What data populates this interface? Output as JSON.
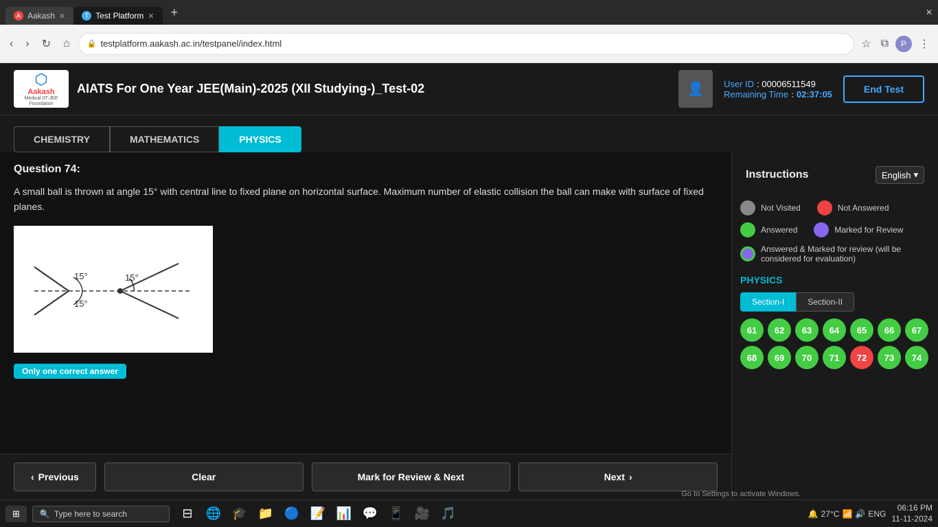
{
  "browser": {
    "tabs": [
      {
        "id": "aakash",
        "label": "Aakash",
        "active": false,
        "favicon": "A"
      },
      {
        "id": "test",
        "label": "Test Platform",
        "active": true,
        "favicon": "T"
      }
    ],
    "address": "testplatform.aakash.ac.in/testpanel/index.html",
    "new_tab_label": "+"
  },
  "header": {
    "logo_text": "Aakash",
    "logo_sub": "Medical IIT-JEE Foundation",
    "test_title": "AIATS For One Year JEE(Main)-2025 (XII Studying-)_Test-02",
    "user_id_label": "User ID",
    "user_id_value": ": 00006511549",
    "remaining_label": "Remaining Time",
    "remaining_value": ": 02:37:05",
    "end_test_label": "End Test"
  },
  "tabs": {
    "chemistry_label": "CHEMISTRY",
    "mathematics_label": "MATHEMATICS",
    "physics_label": "PHYSICS",
    "active": "PHYSICS"
  },
  "question": {
    "title": "Question 74:",
    "text": "A small ball is thrown at angle 15° with central line to fixed plane on horizontal surface. Maximum number of elastic collision the ball can make with surface of fixed planes.",
    "answer_type": "Only one correct answer"
  },
  "bottom_nav": {
    "prev_label": "Previous",
    "clear_label": "Clear",
    "mark_review_label": "Mark for Review & Next",
    "next_label": "Next"
  },
  "right_panel": {
    "instructions_label": "Instructions",
    "language_label": "English",
    "legend": {
      "not_visited_label": "Not Visited",
      "not_answered_label": "Not Answered",
      "answered_label": "Answered",
      "marked_review_label": "Marked for Review",
      "answered_marked_label": "Answered & Marked for review (will be considered for evaluation)"
    },
    "section_label": "PHYSICS",
    "section_tabs": [
      "Section-I",
      "Section-II"
    ],
    "active_section": "Section-I",
    "question_numbers": [
      {
        "num": 61,
        "status": "green"
      },
      {
        "num": 62,
        "status": "green"
      },
      {
        "num": 63,
        "status": "green"
      },
      {
        "num": 64,
        "status": "green"
      },
      {
        "num": 65,
        "status": "green"
      },
      {
        "num": 66,
        "status": "green"
      },
      {
        "num": 67,
        "status": "green"
      },
      {
        "num": 68,
        "status": "green"
      },
      {
        "num": 69,
        "status": "green"
      },
      {
        "num": 70,
        "status": "green"
      },
      {
        "num": 71,
        "status": "green"
      },
      {
        "num": 72,
        "status": "red"
      },
      {
        "num": 73,
        "status": "green"
      },
      {
        "num": 74,
        "status": "green"
      }
    ]
  },
  "taskbar": {
    "start_label": "⊞",
    "search_placeholder": "Type here to search",
    "time": "06:16 PM",
    "date": "11-11-2024",
    "temp": "27°C",
    "lang": "ENG",
    "activate_notice": "Go to Settings to activate Windows."
  }
}
